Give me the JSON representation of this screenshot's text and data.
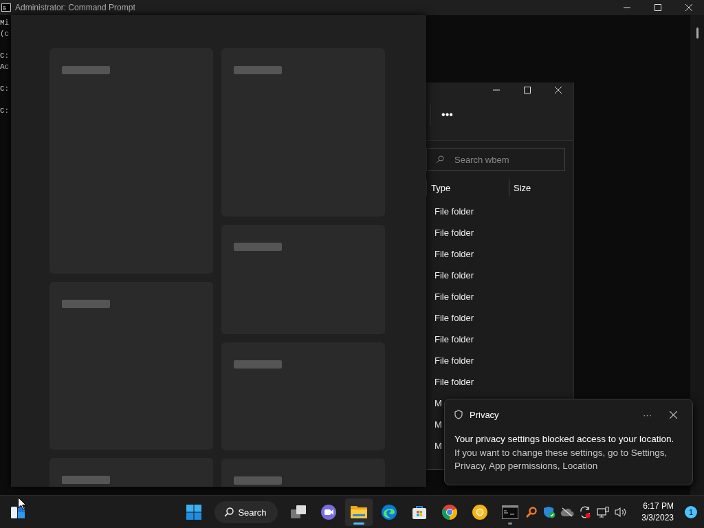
{
  "background_window": {
    "title": "Administrator: Command Prompt",
    "blocks": [
      [
        "Mi",
        "(c"
      ],
      [
        "C:",
        "Ac"
      ],
      [
        "C:"
      ],
      [
        "C:"
      ]
    ]
  },
  "widgets_panel": {
    "loading": true
  },
  "explorer": {
    "more_label": "•••",
    "search_placeholder": "Search wbem",
    "columns": [
      "Type",
      "Size"
    ],
    "rows": [
      {
        "type": "File folder"
      },
      {
        "type": "File folder"
      },
      {
        "type": "File folder"
      },
      {
        "type": "File folder"
      },
      {
        "type": "File folder"
      },
      {
        "type": "File folder"
      },
      {
        "type": "File folder"
      },
      {
        "type": "File folder"
      },
      {
        "type": "File folder"
      },
      {
        "type": "M"
      },
      {
        "type": "M"
      },
      {
        "type": "M"
      }
    ]
  },
  "toast": {
    "app": "Privacy",
    "more_label": "···",
    "title": "Your privacy settings blocked access to your location.",
    "body": "If you want to change these settings, go to Settings, Privacy, App permissions, Location"
  },
  "taskbar": {
    "search_label": "Search",
    "apps": [
      {
        "kind": "taskview",
        "active": false,
        "running": false
      },
      {
        "kind": "chat",
        "active": false,
        "running": false
      },
      {
        "kind": "explorer",
        "active": true,
        "running": false
      },
      {
        "kind": "edge",
        "active": false,
        "running": false
      },
      {
        "kind": "store",
        "active": false,
        "running": false
      },
      {
        "kind": "chrome",
        "active": false,
        "running": false
      },
      {
        "kind": "canary",
        "active": false,
        "running": false
      },
      {
        "kind": "terminal",
        "active": false,
        "running": true
      }
    ],
    "tray": [
      {
        "kind": "magnifier"
      },
      {
        "kind": "shield"
      },
      {
        "kind": "cloud"
      },
      {
        "kind": "sync"
      },
      {
        "kind": "network"
      },
      {
        "kind": "volume"
      }
    ],
    "time": "6:17 PM",
    "date": "3/3/2023",
    "notification_count": "1"
  }
}
